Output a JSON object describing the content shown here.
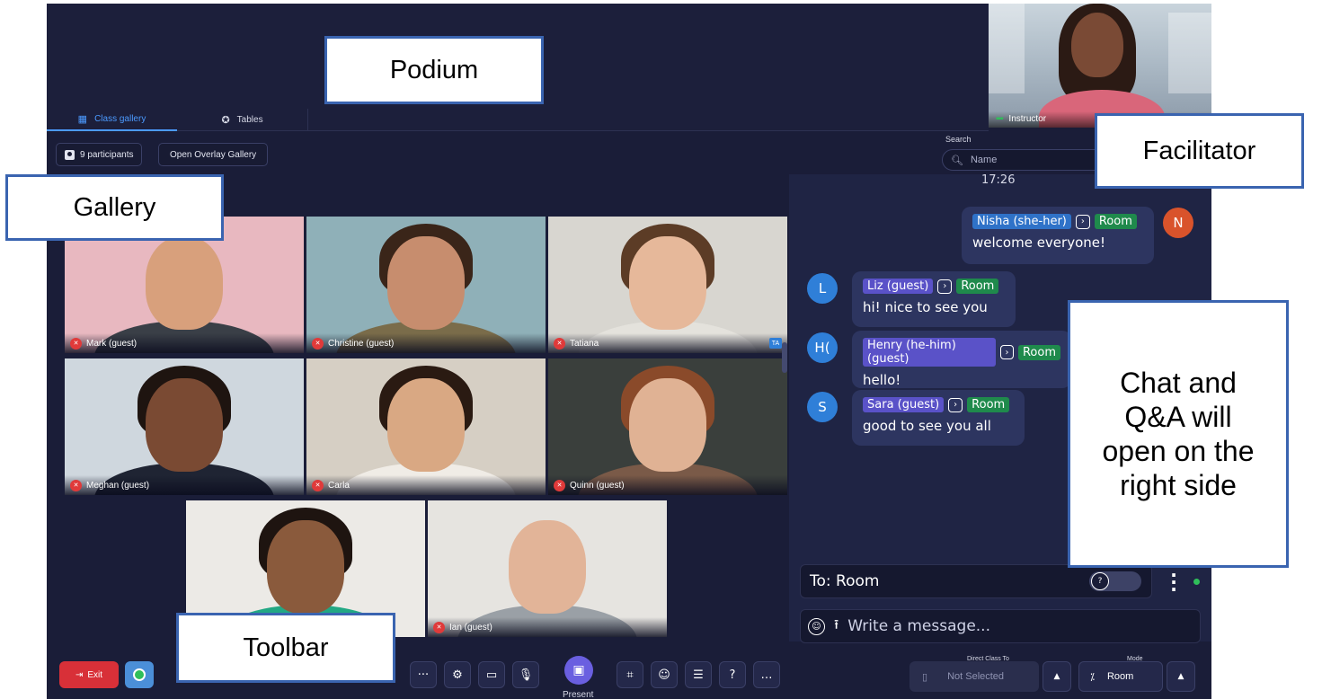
{
  "tabs": [
    {
      "label": "Class gallery",
      "icon": "grid-icon"
    },
    {
      "label": "Tables",
      "icon": "tables-icon"
    }
  ],
  "instructor": {
    "label": "Instructor"
  },
  "gallery": {
    "participants_label": "9 participants",
    "overlay_label": "Open Overlay Gallery",
    "tiles": [
      {
        "name": "Mark (guest)"
      },
      {
        "name": "Christine (guest)"
      },
      {
        "name": "Tatiana",
        "badge": "TA"
      },
      {
        "name": "Meghan (guest)"
      },
      {
        "name": "Carla"
      },
      {
        "name": "Quinn (guest)"
      },
      {
        "name": ""
      },
      {
        "name": "Ian (guest)"
      }
    ]
  },
  "search": {
    "label": "Search",
    "placeholder": "Name"
  },
  "chat": {
    "time": "17:26",
    "messages": [
      {
        "avatar": "N",
        "sender": "Nisha (she-her)",
        "to": "Room",
        "text": "welcome everyone!",
        "avatar_color": "#d9532b"
      },
      {
        "avatar": "L",
        "sender": "Liz (guest)",
        "to": "Room",
        "text": "hi! nice to see you",
        "avatar_color": "#2f7fd8"
      },
      {
        "avatar": "H(",
        "sender": "Henry (he-him) (guest)",
        "to": "Room",
        "text": "hello!",
        "avatar_color": "#2f7fd8"
      },
      {
        "avatar": "S",
        "sender": "Sara (guest)",
        "to": "Room",
        "text": "good to see you all",
        "avatar_color": "#2f7fd8"
      }
    ],
    "to_label": "To: Room",
    "message_placeholder": "Write a message..."
  },
  "toolbar": {
    "exit_label": "Exit",
    "present_label": "Present",
    "direct_class_label": "Direct Class To",
    "direct_class_value": "Not Selected",
    "mode_label": "Mode",
    "mode_value": "Room"
  },
  "annotations": {
    "podium": "Podium",
    "facilitator": "Facilitator",
    "gallery": "Gallery",
    "chat_line1": "Chat and",
    "chat_line2": "Q&A will",
    "chat_line3": "open on the",
    "chat_line4": "right side",
    "toolbar": "Toolbar"
  },
  "colors": {
    "background": "#1a1d38",
    "accent": "#4b9aff",
    "exit": "#d83038",
    "present": "#6a5fe0",
    "room_tag": "#1f8a4c",
    "callout_border": "#3a64b0"
  }
}
